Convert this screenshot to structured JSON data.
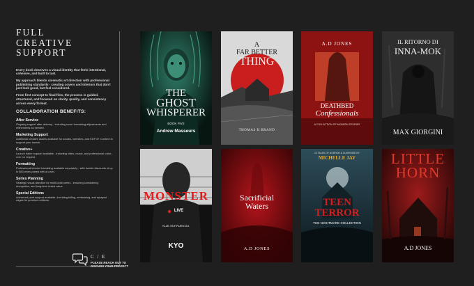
{
  "header": {
    "title_line1": "FULL",
    "title_line2": "CREATIVE",
    "title_line3": "SUPPORT"
  },
  "intro": [
    "Every book deserves a visual identity that feels intentional, cohesive, and built to last.",
    "My approach blends cinematic art direction with professional publishing standards - creating covers and interiors that don't just look good, but feel considered.",
    "From first concept to final files, the process is guided, structured, and focused on clarity, quality, and consistency across every format."
  ],
  "collab_heading": "COLLABORATION BENEFITS:",
  "benefits": [
    {
      "title": "After Service",
      "desc": "Ongoing support after delivery - including cover formatting adjustments and refinements as needed."
    },
    {
      "title": "Marketing Support",
      "desc": "Additional creative assets available for socials, websites, and KDP A+ Content to support your launch."
    },
    {
      "title": "Creative+",
      "desc": "Launch trailer support available - including video, music, and professional voice-over on request."
    },
    {
      "title": "Formatting",
      "desc": "Professional interior formatting available separately - with bundle discounts of up to $50 when paired with a cover."
    },
    {
      "title": "Series Planning",
      "desc": "Strategic visual direction for multi-book series - ensuring consistency, recognition, and long-term brand value."
    },
    {
      "title": "Special Editions",
      "desc": "Advanced print support available, including foiling, embossing, and sprayed edges for premium editions."
    }
  ],
  "footer": {
    "brand": "C / E",
    "cta_line1": "PLEASE REACH OUT TO",
    "cta_line2": "DISCUSS YOUR PROJECT"
  },
  "icons": {
    "contact": "chat-bubbles-icon"
  },
  "colors": {
    "background": "#1f1f1f",
    "accent_red": "#c81e1e",
    "accent_green": "#3fae8c"
  },
  "covers": [
    {
      "title_a": "THE",
      "title_b": "GHOST",
      "title_c": "WHISPERER",
      "series": "BOOK FIVE",
      "author": "Andrew Masseurs"
    },
    {
      "title_a": "A",
      "title_b": "FAR BETTER",
      "title_c": "THING",
      "author": "THOMAS H BRAND"
    },
    {
      "author_top": "A.D JONES",
      "title_a": "DEATHBED",
      "title_b": "Confessionals",
      "tagline": "A COLLECTION OF MODERN STORIES"
    },
    {
      "title_a": "IL RITORNO DI",
      "title_b": "INNA-MOK",
      "author": "MAX GIORGINI"
    },
    {
      "title_a": "MONSTER",
      "live": "LIVE",
      "tagline": "ALLE SCHAUEN ZU.",
      "author": "KYO"
    },
    {
      "title_a": "Sacrificial",
      "title_b": "Waters",
      "author": "A.D JONES"
    },
    {
      "tagline_top": "13 TALES OF HORROR & SUSPENSE BY",
      "author_top": "MICHELLE JAY",
      "title_a": "TEEN",
      "title_b": "TERROR",
      "subtitle": "THE NIGHTMARE COLLECTION"
    },
    {
      "title_a": "LITTLE",
      "title_b": "HORN",
      "author": "A.D JONES"
    }
  ]
}
